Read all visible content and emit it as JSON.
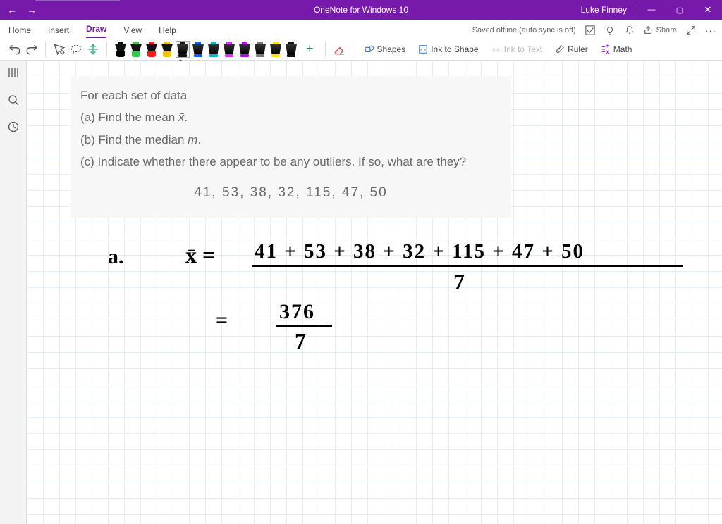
{
  "titlebar": {
    "app_title": "OneNote for Windows 10",
    "username": "Luke Finney"
  },
  "menu": {
    "home": "Home",
    "insert": "Insert",
    "draw": "Draw",
    "view": "View",
    "help": "Help",
    "saved_status": "Saved offline (auto sync is off)",
    "share": "Share"
  },
  "toolbar": {
    "shapes": "Shapes",
    "ink_to_shape": "Ink to Shape",
    "ink_to_text": "Ink to Text",
    "ruler": "Ruler",
    "math": "Math",
    "pen_colors": [
      "#000000",
      "#2ecc40",
      "#ff1a1a",
      "#f5c400",
      "#111111",
      "#0b5fff",
      "#00b8d4",
      "#d633ff",
      "#b700ff",
      "#7a7a7a",
      "#ffe600",
      "#111111"
    ],
    "selected_pen_index": 4
  },
  "problem": {
    "intro": "For each set of data",
    "a": "(a) Find the mean x̄.",
    "b": "(b) Find the median m.",
    "c": "(c) Indicate whether there appear to be any outliers. If so, what are they?",
    "data_row": "41,   53,   38,   32,   115,   47,   50"
  },
  "handwriting": {
    "label_a": "a.",
    "xbar": "x̄  =",
    "numerator": "41 + 53 + 38 + 32 + 115 + 47 + 50",
    "denom": "7",
    "eq2": "=",
    "frac2_num": "376",
    "frac2_den": "7"
  }
}
